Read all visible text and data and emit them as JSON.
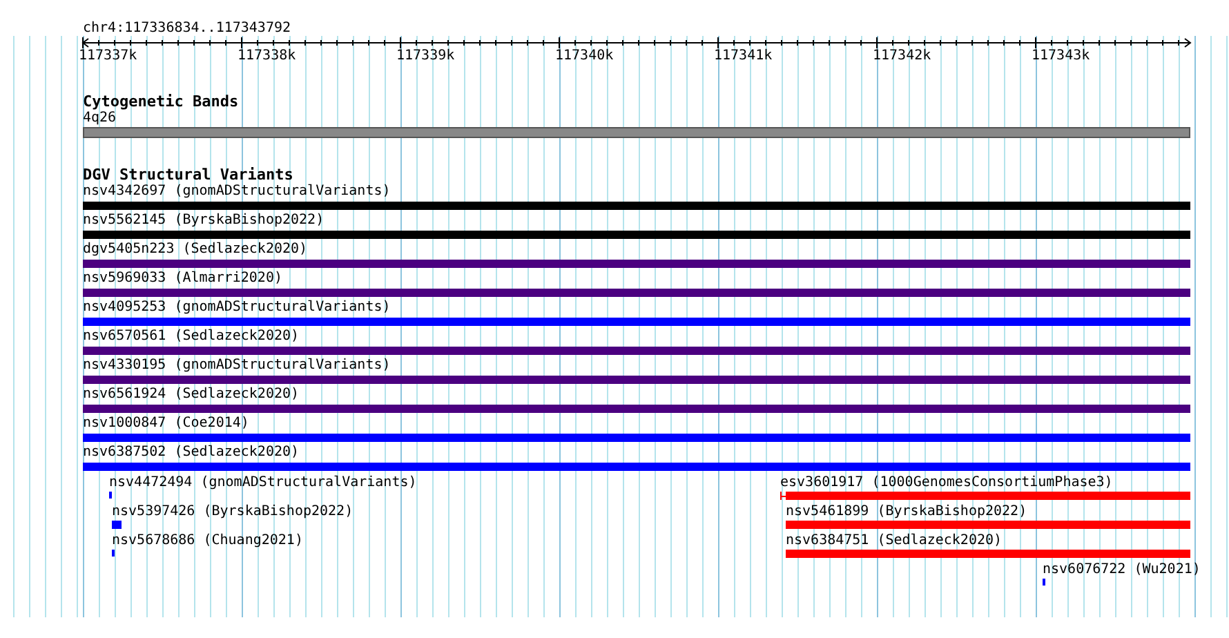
{
  "position": "chr4:117336834..117343792",
  "ruler": {
    "labels": [
      "117337k",
      "117338k",
      "117339k",
      "117340k",
      "117341k",
      "117342k",
      "117343k"
    ]
  },
  "cytogenetic_bands": {
    "title": "Cytogenetic Bands",
    "band_label": "4q26"
  },
  "dgv": {
    "title": "DGV Structural Variants",
    "rows": [
      {
        "label": "nsv4342697 (gnomADStructuralVariants)",
        "color": "#000000"
      },
      {
        "label": "nsv5562145 (ByrskaBishop2022)",
        "color": "#000000"
      },
      {
        "label": "dgv5405n223 (Sedlazeck2020)",
        "color": "#4b0080"
      },
      {
        "label": "nsv5969033 (Almarri2020)",
        "color": "#4b0080"
      },
      {
        "label": "nsv4095253 (gnomADStructuralVariants)",
        "color": "#0000ff"
      },
      {
        "label": "nsv6570561 (Sedlazeck2020)",
        "color": "#4b0080"
      },
      {
        "label": "nsv4330195 (gnomADStructuralVariants)",
        "color": "#4b0080"
      },
      {
        "label": "nsv6561924 (Sedlazeck2020)",
        "color": "#4b0080"
      },
      {
        "label": "nsv1000847 (Coe2014)",
        "color": "#0000ff"
      },
      {
        "label": "nsv6387502 (Sedlazeck2020)",
        "color": "#0000ff"
      }
    ],
    "features": [
      {
        "label": "nsv4472494 (gnomADStructuralVariants)",
        "color": "#0000ff"
      },
      {
        "label": "esv3601917 (1000GenomesConsortiumPhase3)",
        "color": "#ff0000"
      },
      {
        "label": "nsv5397426 (ByrskaBishop2022)",
        "color": "#0000ff"
      },
      {
        "label": "nsv5461899 (ByrskaBishop2022)",
        "color": "#ff0000"
      },
      {
        "label": "nsv5678686 (Chuang2021)",
        "color": "#0000ff"
      },
      {
        "label": "nsv6384751 (Sedlazeck2020)",
        "color": "#ff0000"
      },
      {
        "label": "nsv6076722 (Wu2021)",
        "color": "#0000ff"
      }
    ]
  }
}
